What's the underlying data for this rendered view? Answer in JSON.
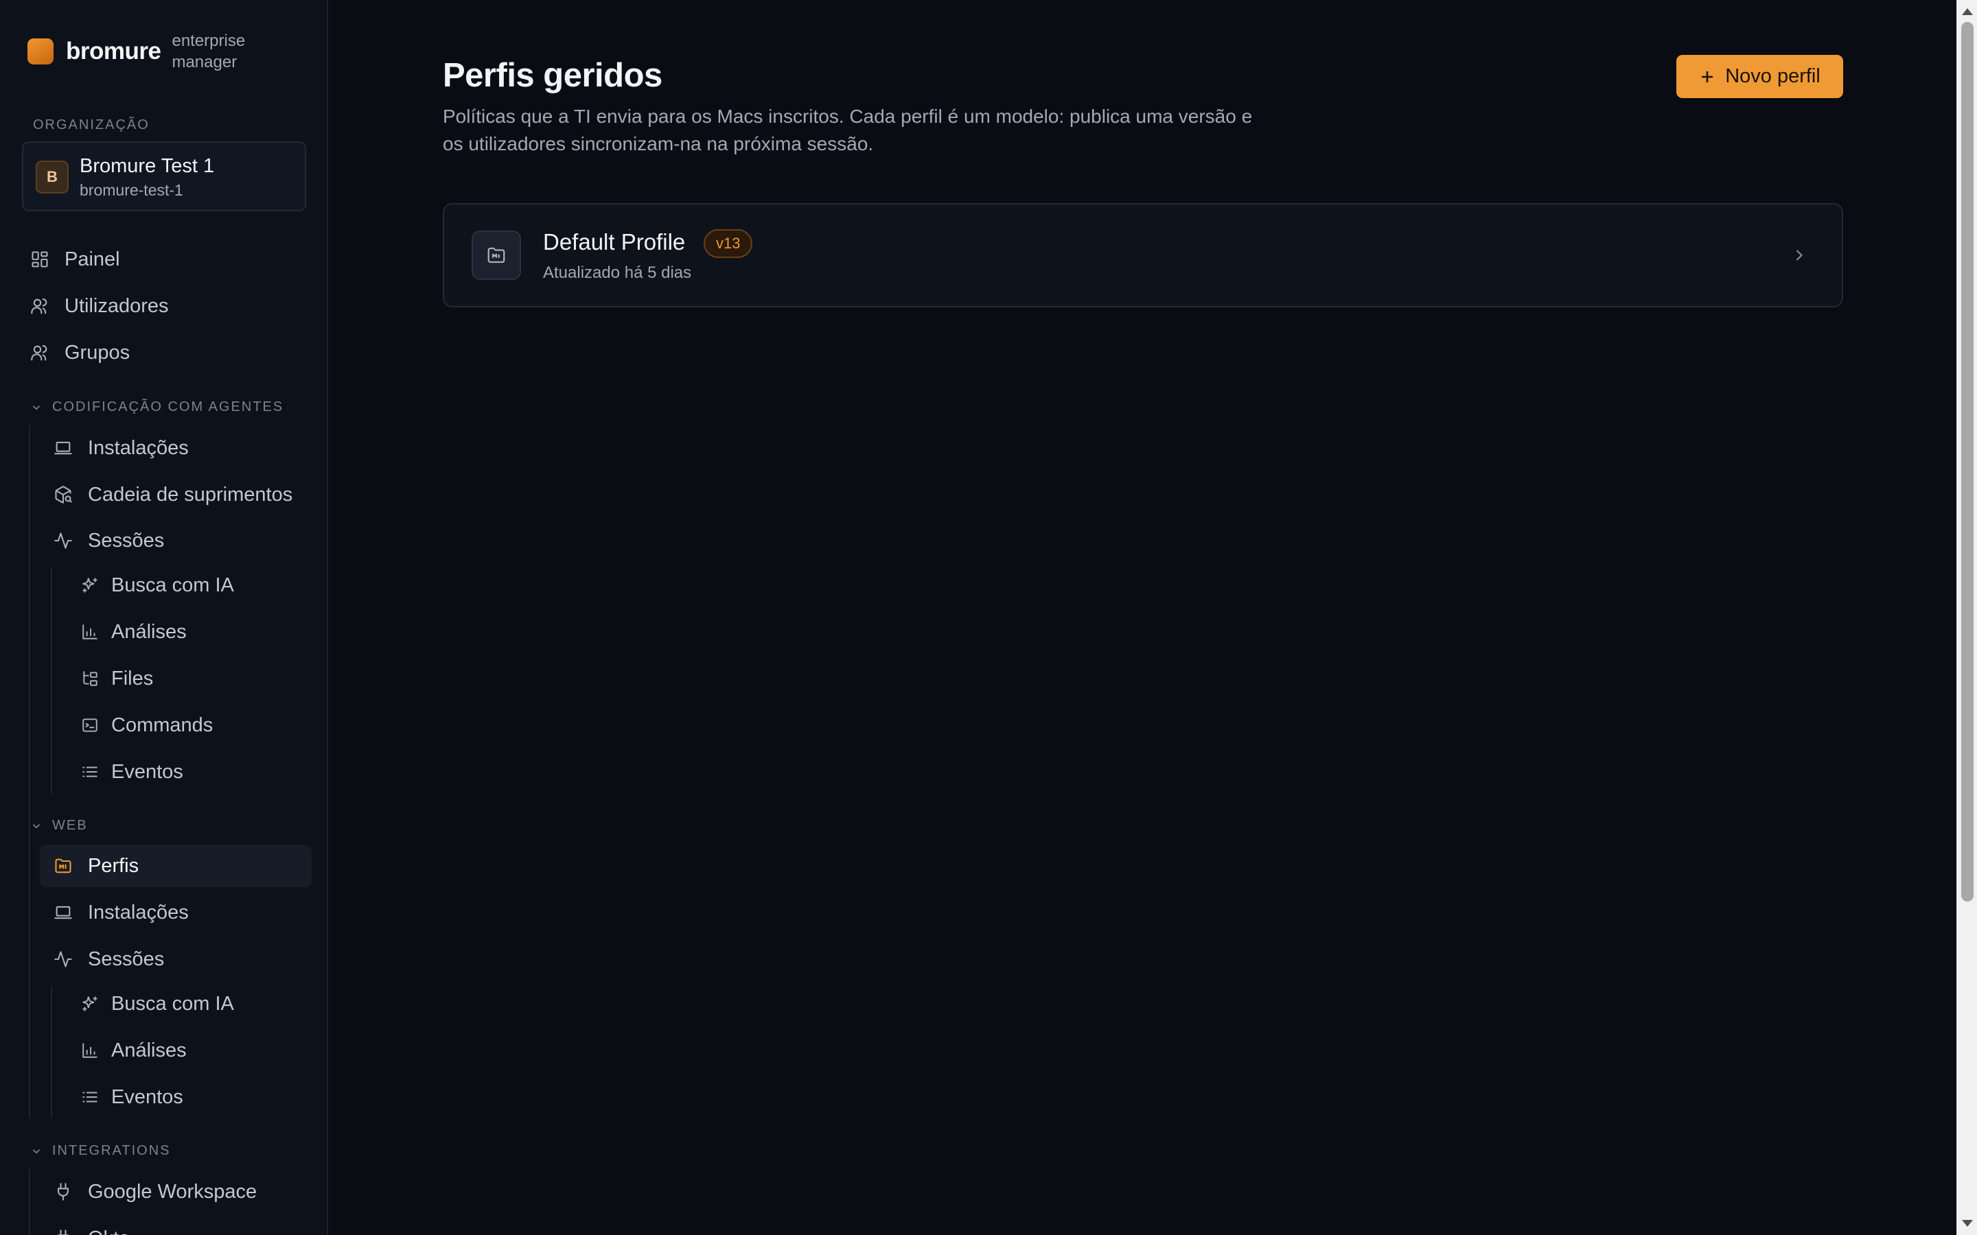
{
  "brand": {
    "name": "bromure",
    "subtitle": "enterprise manager"
  },
  "organization": {
    "section_label": "ORGANIZAÇÃO",
    "avatar_letter": "B",
    "name": "Bromure Test 1",
    "slug": "bromure-test-1"
  },
  "nav": {
    "painel": "Painel",
    "utilizadores": "Utilizadores",
    "grupos": "Grupos"
  },
  "agents_group": {
    "label": "CODIFICAÇÃO COM AGENTES",
    "instalacoes": "Instalações",
    "cadeia": "Cadeia de suprimentos",
    "sessoes": "Sessões",
    "busca": "Busca com IA",
    "analises": "Análises",
    "files": "Files",
    "commands": "Commands",
    "eventos": "Eventos"
  },
  "web_group": {
    "label": "WEB",
    "perfis": "Perfis",
    "instalacoes": "Instalações",
    "sessoes": "Sessões",
    "busca": "Busca com IA",
    "analises": "Análises",
    "eventos": "Eventos"
  },
  "integrations_group": {
    "label": "INTEGRATIONS",
    "google": "Google Workspace",
    "next_item": "Okta"
  },
  "main": {
    "title": "Perfis geridos",
    "description": "Políticas que a TI envia para os Macs inscritos. Cada perfil é um modelo: publica uma versão e os utilizadores sincronizam-na na próxima sessão.",
    "new_button": "Novo perfil"
  },
  "profiles": [
    {
      "name": "Default Profile",
      "version": "v13",
      "updated": "Atualizado há 5 dias"
    }
  ],
  "colors": {
    "accent": "#ef9a35",
    "background": "#090c13",
    "sidebar": "#0c111a"
  }
}
